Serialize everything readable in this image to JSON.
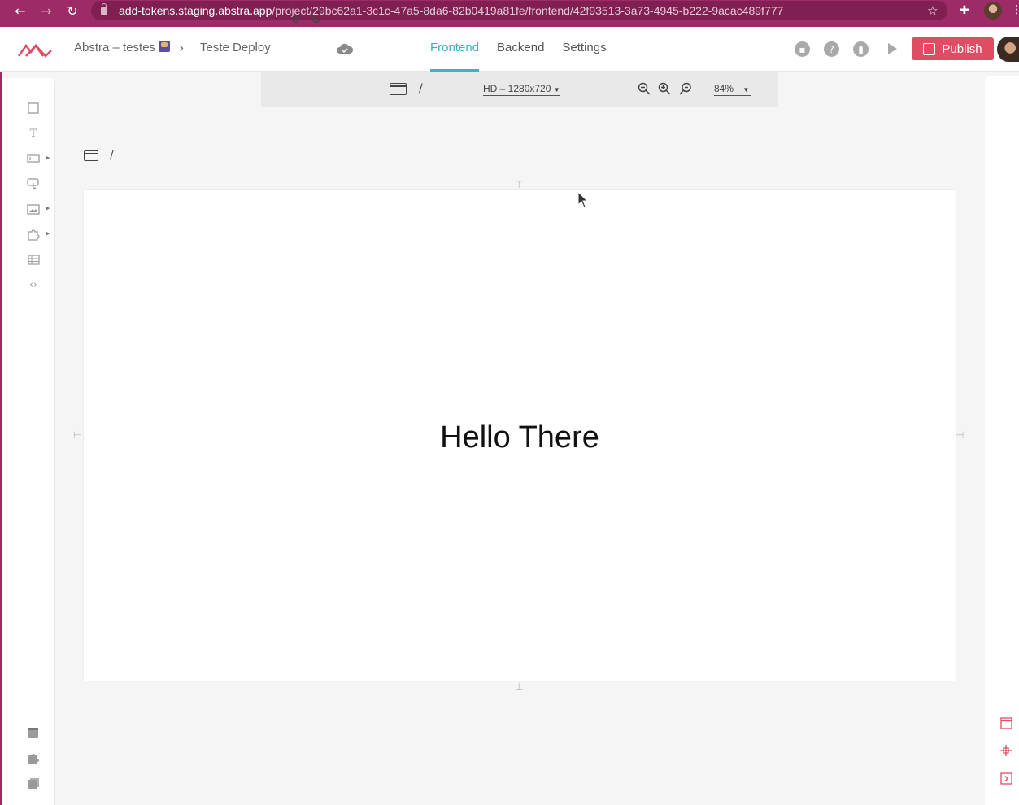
{
  "browser": {
    "url_host": "add-tokens.staging.abstra.app",
    "url_path": "/project/29bc62a1-3c1c-47a5-8da6-82b0419a81fe/frontend/42f93513-3a73-4945-b222-9acac489f777"
  },
  "header": {
    "project_name": "Abstra – testes",
    "page_name": "Teste Deploy",
    "tabs": [
      {
        "label": "Frontend",
        "active": true
      },
      {
        "label": "Backend",
        "active": false
      },
      {
        "label": "Settings",
        "active": false
      }
    ],
    "publish_label": "Publish",
    "accent": "#36b5c5",
    "publish_color": "#e04d63"
  },
  "canvas_toolbar": {
    "route": "/",
    "resolution": "HD – 1280x720",
    "zoom": "84%"
  },
  "canvas": {
    "route": "/",
    "heading": "Hello There"
  },
  "left_toolbar": {
    "tools": [
      "container-icon",
      "text-icon",
      "input-icon",
      "button-icon",
      "image-icon",
      "widget-icon",
      "table-icon",
      "code-icon"
    ],
    "bottom": [
      "page-icon",
      "plugin-icon",
      "pages-icon"
    ]
  },
  "right_toolbar": {
    "icons": [
      "frame-icon",
      "move-icon",
      "collapse-icon"
    ]
  }
}
